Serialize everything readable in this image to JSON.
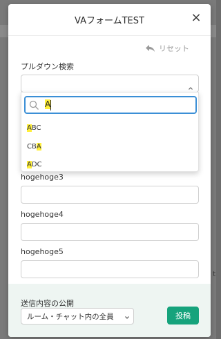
{
  "background": {
    "right_edge_text": "t"
  },
  "modal": {
    "title": "VAフォームTEST",
    "close_icon": "×"
  },
  "reset": {
    "label": "リセット",
    "icon": "reply-arrow-icon"
  },
  "pulldown_field": {
    "label": "プルダウン検索",
    "selected_value": "",
    "search": {
      "value": "A",
      "icon": "search-icon"
    },
    "options": [
      {
        "label": "ABC",
        "before": "",
        "match": "A",
        "after": "BC"
      },
      {
        "label": "CBA",
        "before": "CB",
        "match": "A",
        "after": ""
      },
      {
        "label": "ADC",
        "before": "",
        "match": "A",
        "after": "DC"
      }
    ]
  },
  "fields": [
    {
      "label": "hogehoge3",
      "value": ""
    },
    {
      "label": "hogehoge4",
      "value": ""
    },
    {
      "label": "hogehoge5",
      "value": ""
    }
  ],
  "footer": {
    "visibility_label": "送信内容の公開",
    "visibility_value": "ルーム・チャット内の全員",
    "post_label": "投稿"
  },
  "colors": {
    "accent": "#16a37c",
    "focus": "#3b8fd6",
    "highlight": "#ffef3b",
    "footer_bg": "#eef5f2"
  }
}
